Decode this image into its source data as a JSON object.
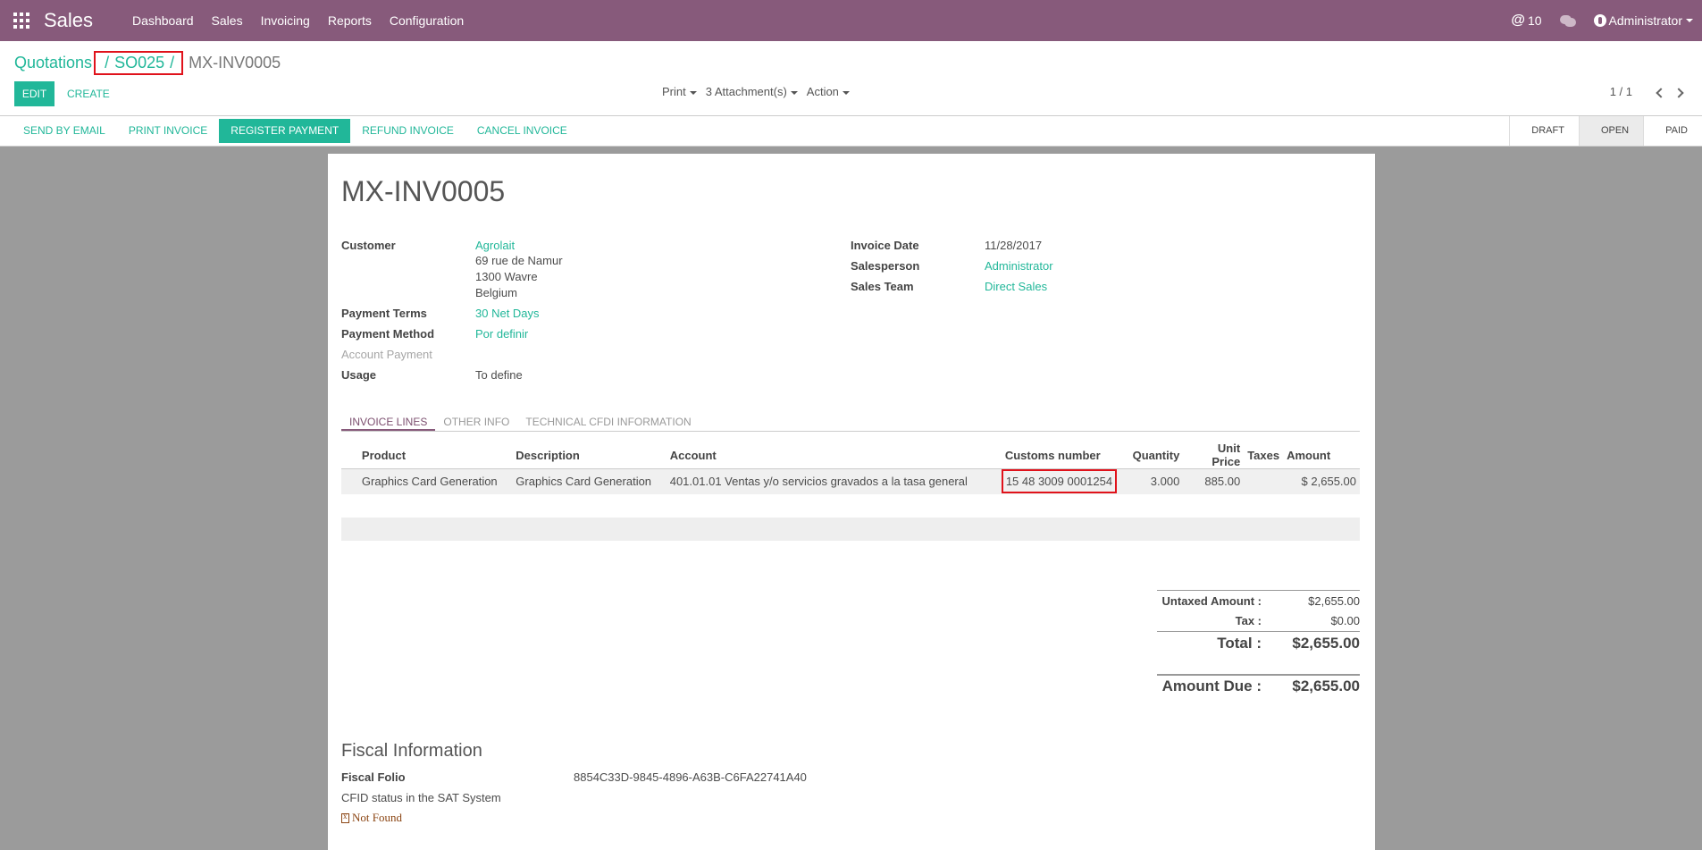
{
  "navbar": {
    "brand": "Sales",
    "menu": [
      "Dashboard",
      "Sales",
      "Invoicing",
      "Reports",
      "Configuration"
    ],
    "mentions_count": "10",
    "user": "Administrator"
  },
  "breadcrumb": {
    "root": "Quotations",
    "sep": "/",
    "order": "SO025",
    "current": "MX-INV0005"
  },
  "actions": {
    "edit": "EDIT",
    "create": "CREATE",
    "print": "Print",
    "attachments": "3 Attachment(s)",
    "action": "Action",
    "pager": "1 / 1"
  },
  "statusbar": {
    "buttons": [
      "SEND BY EMAIL",
      "PRINT INVOICE",
      "REGISTER PAYMENT",
      "REFUND INVOICE",
      "CANCEL INVOICE"
    ],
    "stages": [
      "DRAFT",
      "OPEN",
      "PAID"
    ],
    "active_stage": "OPEN"
  },
  "invoice": {
    "title": "MX-INV0005",
    "labels": {
      "customer": "Customer",
      "payment_terms": "Payment Terms",
      "payment_method": "Payment Method",
      "account_payment": "Account Payment",
      "usage": "Usage",
      "invoice_date": "Invoice Date",
      "salesperson": "Salesperson",
      "sales_team": "Sales Team"
    },
    "customer": "Agrolait",
    "address": [
      "69 rue de Namur",
      "1300 Wavre",
      "Belgium"
    ],
    "payment_terms": "30 Net Days",
    "payment_method": "Por definir",
    "usage": "To define",
    "invoice_date": "11/28/2017",
    "salesperson": "Administrator",
    "sales_team": "Direct Sales"
  },
  "tabs": [
    "INVOICE LINES",
    "OTHER INFO",
    "TECHNICAL CFDI INFORMATION"
  ],
  "lines": {
    "headers": [
      "Product",
      "Description",
      "Account",
      "Customs number",
      "Quantity",
      "Unit Price",
      "Taxes",
      "Amount"
    ],
    "rows": [
      {
        "product": "Graphics Card Generation",
        "description": "Graphics Card Generation",
        "account": "401.01.01 Ventas y/o servicios gravados a la tasa general",
        "customs": "15 48 3009 0001254",
        "quantity": "3.000",
        "unit_price": "885.00",
        "taxes": "",
        "amount": "$ 2,655.00"
      }
    ]
  },
  "totals": {
    "untaxed_label": "Untaxed Amount :",
    "untaxed": "$2,655.00",
    "tax_label": "Tax :",
    "tax": "$0.00",
    "total_label": "Total :",
    "total": "$2,655.00",
    "due_label": "Amount Due :",
    "due": "$2,655.00"
  },
  "fiscal": {
    "title": "Fiscal Information",
    "folio_label": "Fiscal Folio",
    "folio": "8854C33D-9845-4896-A63B-C6FA22741A40",
    "status_label": "CFID status in the SAT System",
    "status": "Not Found"
  }
}
